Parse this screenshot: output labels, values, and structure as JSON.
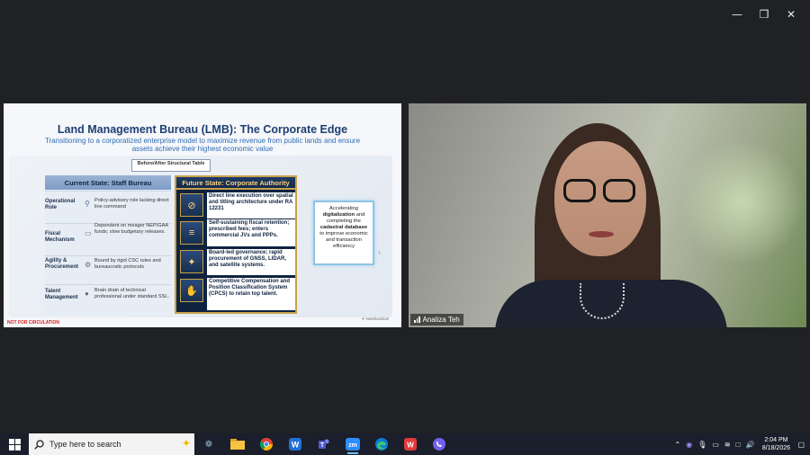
{
  "window": {
    "controls": [
      "—",
      "❐",
      "✕"
    ]
  },
  "slide": {
    "title": "Land Management Bureau (LMB): The Corporate Edge",
    "subtitle": "Transitioning to a corporatized enterprise model to maximize revenue from public lands and ensure assets achieve their highest economic value",
    "before_after_label": "Before/After Structural Table",
    "current_state_header": "Current State: Staff Bureau",
    "future_state_header": "Future State: Corporate Authority",
    "rows": [
      {
        "label": "Operational Role",
        "current": "Policy-advisory role lacking direct line command",
        "future": "Direct line execution over spatial and titling architecture under RA 12231"
      },
      {
        "label": "Fiscal Mechanism",
        "current": "Dependent on meager NEP/GAA funds; slow budgetary releases.",
        "future": "Self-sustaining fiscal retention; prescribed fees; enters commercial JVs and PPPs."
      },
      {
        "label": "Agility & Procurement",
        "current": "Bound by rigid CSC rules and bureaucratic protocols",
        "future": "Board-led governance; rapid procurement of GNSS, LIDAR, and satellite systems."
      },
      {
        "label": "Talent Management",
        "current": "Brain drain of technical professional under standard SSL.",
        "future": "Competitive Compensation and Position Classification System (CPCS) to retain top talent."
      }
    ],
    "side_box": {
      "t1": "Accelerating",
      "b1": "digitalization",
      "t2": "and completing the",
      "b2": "cadastral database",
      "t3": "to improve economic and transaction efficiency"
    },
    "footer_left": "NOT FOR CIRCULATION",
    "footer_right": "✦ NotebookLM"
  },
  "video": {
    "participant_name": "Analiza Teh"
  },
  "taskbar": {
    "search_placeholder": "Type here to search",
    "time": "2:04 PM",
    "date": "8/18/2026"
  }
}
